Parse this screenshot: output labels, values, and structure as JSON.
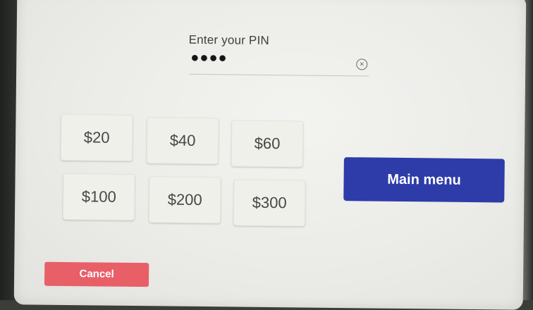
{
  "pin": {
    "label": "Enter your PIN",
    "masked_value": "●●●●",
    "clear_icon": "×"
  },
  "amounts": [
    "$20",
    "$40",
    "$60",
    "$100",
    "$200",
    "$300"
  ],
  "actions": {
    "main_menu": "Main menu",
    "cancel": "Cancel"
  },
  "colors": {
    "main_menu": "#2d3ca9",
    "cancel": "#e85f68",
    "screen": "#ebebe8"
  },
  "icons": {
    "clear": "clear-icon"
  }
}
